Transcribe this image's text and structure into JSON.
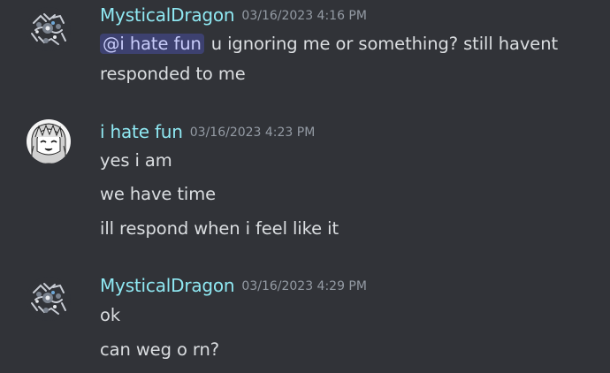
{
  "colors": {
    "background": "#313338",
    "username": "#8fe8f2",
    "timestamp": "#949ba4",
    "text": "#dbdee1",
    "mention_bg": "#3c4270",
    "mention_text": "#c9cdfb"
  },
  "messages": [
    {
      "author": "MysticalDragon",
      "timestamp": "03/16/2023 4:16 PM",
      "avatar_icon": "dragon-avatar-icon",
      "mention": "@i hate fun",
      "lines": [
        "u ignoring me or something? still havent",
        "responded to me"
      ]
    },
    {
      "author": "i hate fun",
      "timestamp": "03/16/2023 4:23 PM",
      "avatar_icon": "anime-girl-avatar-icon",
      "lines": [
        "yes i am",
        "we have time",
        "ill respond when i feel like it"
      ]
    },
    {
      "author": "MysticalDragon",
      "timestamp": "03/16/2023 4:29 PM",
      "avatar_icon": "dragon-avatar-icon",
      "lines": [
        "ok",
        "can weg o rn?"
      ]
    }
  ]
}
